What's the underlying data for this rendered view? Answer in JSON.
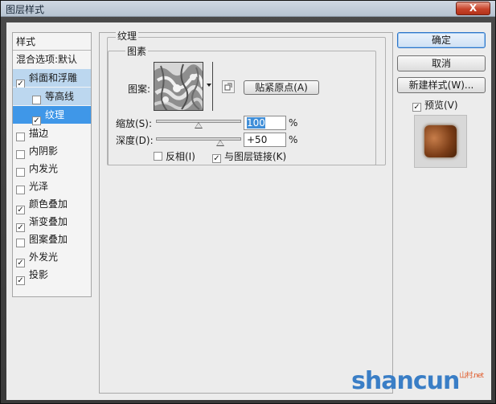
{
  "window": {
    "title": "图层样式",
    "close_label": "X"
  },
  "styles_panel": {
    "header": "样式",
    "items": [
      {
        "label": "混合选项:默认",
        "checked": null,
        "state": "normal"
      },
      {
        "label": "斜面和浮雕",
        "checked": true,
        "state": "selected"
      },
      {
        "label": "等高线",
        "checked": false,
        "state": "sub-selected",
        "indent": true
      },
      {
        "label": "纹理",
        "checked": true,
        "state": "active",
        "indent": true
      },
      {
        "label": "描边",
        "checked": false,
        "state": "normal"
      },
      {
        "label": "内阴影",
        "checked": false,
        "state": "normal"
      },
      {
        "label": "内发光",
        "checked": false,
        "state": "normal"
      },
      {
        "label": "光泽",
        "checked": false,
        "state": "normal"
      },
      {
        "label": "颜色叠加",
        "checked": true,
        "state": "normal"
      },
      {
        "label": "渐变叠加",
        "checked": true,
        "state": "normal"
      },
      {
        "label": "图案叠加",
        "checked": false,
        "state": "normal"
      },
      {
        "label": "外发光",
        "checked": true,
        "state": "normal"
      },
      {
        "label": "投影",
        "checked": true,
        "state": "normal"
      }
    ]
  },
  "texture": {
    "group_title": "纹理",
    "subgroup_title": "图素",
    "pattern_label": "图案:",
    "snap_button": "贴紧原点(A)",
    "scale_label": "缩放(S):",
    "scale_value": "100",
    "scale_level": 100,
    "depth_label": "深度(D):",
    "depth_value": "+50",
    "depth_level": 50,
    "unit": "%",
    "invert_label": "反相(I)",
    "invert_checked": false,
    "link_label": "与图层链接(K)",
    "link_checked": true
  },
  "right": {
    "ok_label": "确定",
    "cancel_label": "取消",
    "new_style_label": "新建样式(W)...",
    "preview_label": "预览(V)",
    "preview_checked": true
  },
  "watermark": {
    "text": "shancun",
    "suffix": "山村.net"
  }
}
